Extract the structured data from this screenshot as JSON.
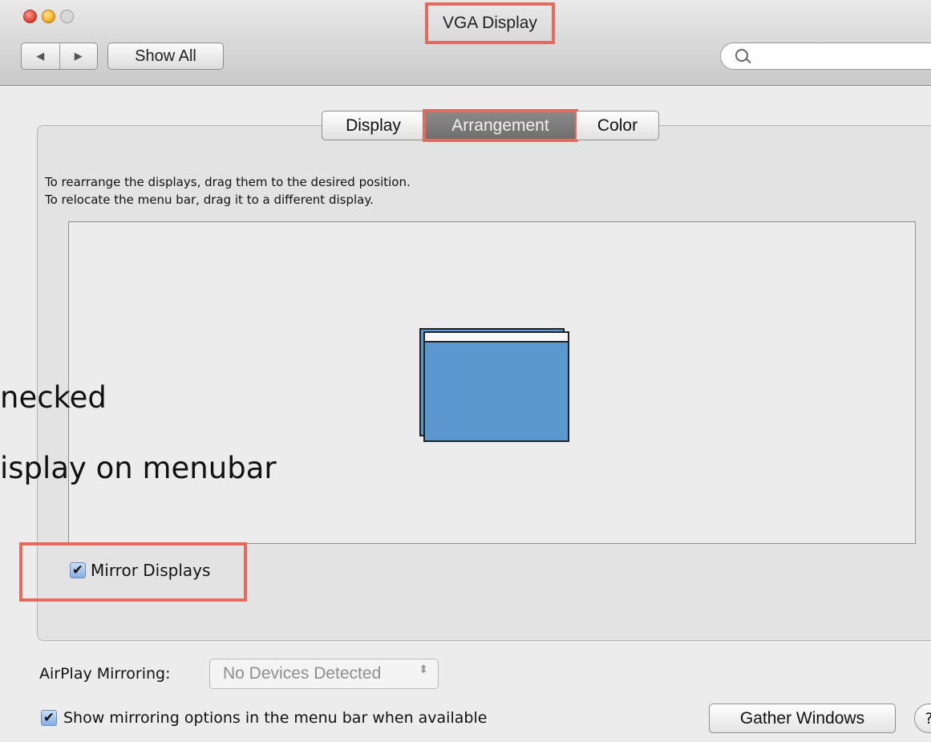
{
  "window": {
    "title": "VGA Display"
  },
  "toolbar": {
    "back_glyph": "◀",
    "forward_glyph": "▶",
    "show_all_label": "Show All",
    "search_placeholder": ""
  },
  "tabs": [
    {
      "label": "Display",
      "selected": false
    },
    {
      "label": "Arrangement",
      "selected": true
    },
    {
      "label": "Color",
      "selected": false
    }
  ],
  "instructions": [
    "To rearrange the displays, drag them to the desired position.",
    "To relocate the menu bar, drag it to a different display."
  ],
  "arrangement": {
    "display_color": "#5b9ad3"
  },
  "mirror": {
    "label": "Mirror Displays",
    "checked": true,
    "check_glyph": "✔"
  },
  "annotation": {
    "line1": "necked",
    "line2": "isplay on menubar"
  },
  "airplay": {
    "label": "AirPlay Mirroring:",
    "value": "No Devices Detected",
    "arrows": "⬍"
  },
  "show_options": {
    "label": "Show mirroring options in the menu bar when available",
    "checked": true,
    "check_glyph": "✔"
  },
  "gather_windows_label": "Gather Windows",
  "help_glyph": "?",
  "colors": {
    "highlight": "#e66a5c",
    "selected_tab": "#7c7c7c"
  }
}
